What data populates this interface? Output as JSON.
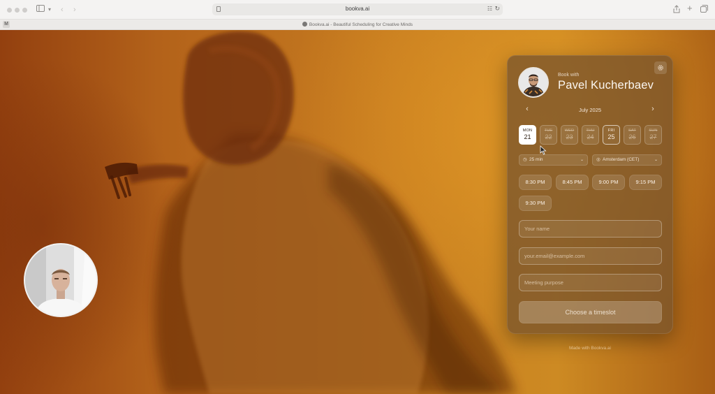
{
  "browser": {
    "url": "bookva.ai",
    "tab_title": "Bookva.ai - Beautiful Scheduling for Creative Minds",
    "tab_favicon": "M"
  },
  "booking": {
    "book_with_label": "Book with",
    "host_name": "Pavel Kucherbaev",
    "month": "July 2025",
    "days": [
      {
        "name": "MON",
        "num": "21",
        "state": "selected"
      },
      {
        "name": "TUE",
        "num": "22",
        "state": "unavailable"
      },
      {
        "name": "WED",
        "num": "23",
        "state": "unavailable"
      },
      {
        "name": "THU",
        "num": "24",
        "state": "unavailable"
      },
      {
        "name": "FRI",
        "num": "25",
        "state": "available"
      },
      {
        "name": "SAT",
        "num": "26",
        "state": "unavailable"
      },
      {
        "name": "SUN",
        "num": "27",
        "state": "unavailable"
      }
    ],
    "duration": "25 min",
    "timezone": "Amsterdam (CET)",
    "timeslots": [
      "8:30 PM",
      "8:45 PM",
      "9:00 PM",
      "9:15 PM",
      "9:30 PM"
    ],
    "name_placeholder": "Your name",
    "email_placeholder": "your.email@example.com",
    "purpose_placeholder": "Meeting purpose",
    "submit_label": "Choose a timeslot"
  },
  "footer": {
    "made_with": "Made with Bookva.ai"
  },
  "colors": {
    "background_orange": "#c77d20",
    "card": "#7a542c",
    "selected_day": "#ffffff"
  }
}
